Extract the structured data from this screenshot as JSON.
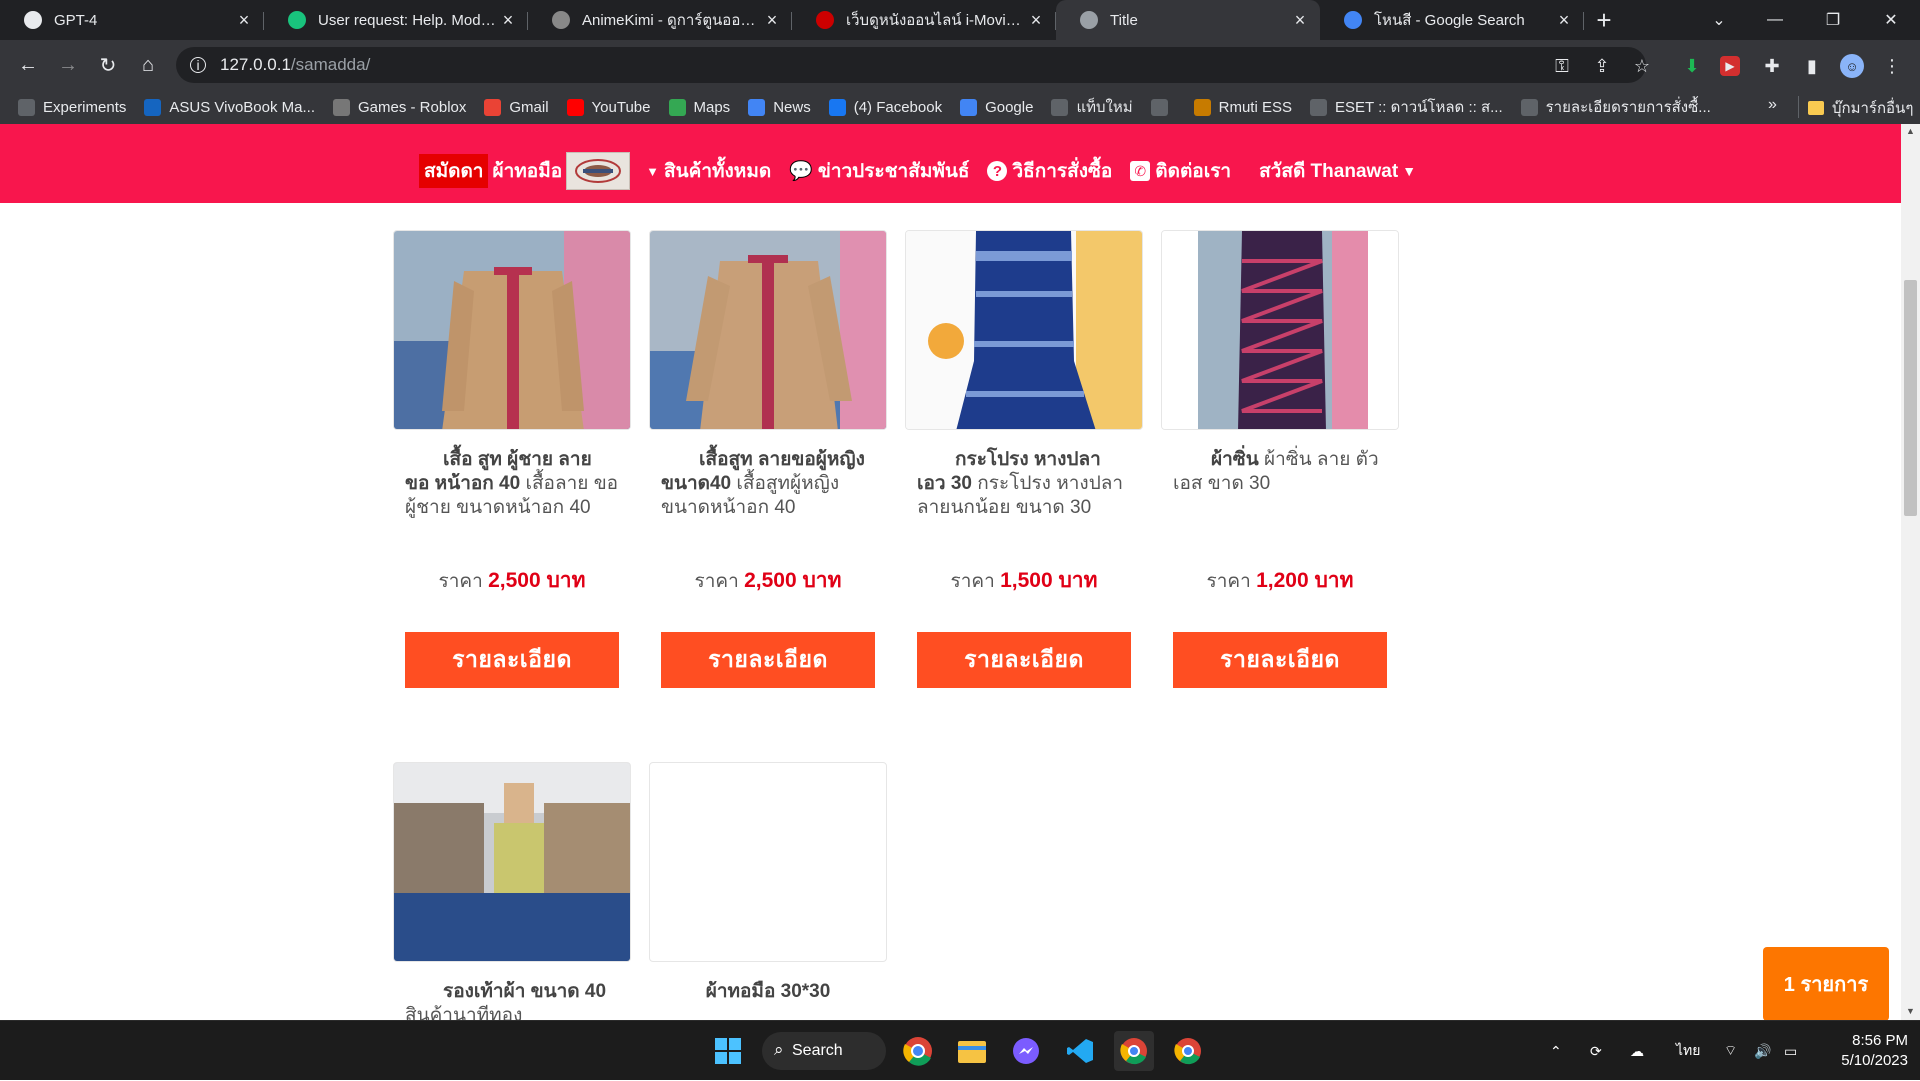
{
  "browser": {
    "tabs": [
      {
        "title": "GPT-4",
        "icon": "openai-icon",
        "color": "#e8eaed"
      },
      {
        "title": "User request: Help. Model r",
        "icon": "openai-icon",
        "color": "#19c37d"
      },
      {
        "title": "AnimeKimi - ดูการ์ตูนออนไลน์",
        "icon": "anime-icon",
        "color": "#888888"
      },
      {
        "title": "เว็บดูหนังออนไลน์ i-MovieHD u",
        "icon": "moviehd-icon",
        "color": "#cc0000"
      },
      {
        "title": "Title",
        "icon": "globe-icon",
        "color": "#9aa0a6",
        "active": true
      },
      {
        "title": "โหนสี - Google Search",
        "icon": "google-icon",
        "color": "#4285f4"
      }
    ],
    "url_host": "127.0.0.1",
    "url_path": "/samadda/",
    "bookmarks": [
      {
        "label": "Experiments",
        "icon": "flask-icon",
        "color": "#5f6368"
      },
      {
        "label": "ASUS VivoBook Ma...",
        "icon": "asus-icon",
        "color": "#1565c0"
      },
      {
        "label": "Games - Roblox",
        "icon": "roblox-icon",
        "color": "#777777"
      },
      {
        "label": "Gmail",
        "icon": "gmail-icon",
        "color": "#ea4335"
      },
      {
        "label": "YouTube",
        "icon": "youtube-icon",
        "color": "#ff0000"
      },
      {
        "label": "Maps",
        "icon": "maps-icon",
        "color": "#34a853"
      },
      {
        "label": "News",
        "icon": "news-icon",
        "color": "#4285f4"
      },
      {
        "label": "(4) Facebook",
        "icon": "facebook-icon",
        "color": "#1877f2"
      },
      {
        "label": "Google",
        "icon": "google-icon",
        "color": "#4285f4"
      },
      {
        "label": "แท็บใหม่",
        "icon": "globe-icon",
        "color": "#5f6368"
      },
      {
        "label": "",
        "icon": "globe-icon",
        "color": "#5f6368"
      },
      {
        "label": "Rmuti ESS",
        "icon": "rmuti-icon",
        "color": "#c77b00"
      },
      {
        "label": "ESET :: ดาวน์โหลด :: ส...",
        "icon": "globe-icon",
        "color": "#5f6368"
      },
      {
        "label": "รายละเอียดรายการสั่งซื้...",
        "icon": "globe-icon",
        "color": "#5f6368"
      }
    ],
    "bookmarks_overflow": "»",
    "other_bookmarks": "บุ๊กมาร์กอื่นๆ"
  },
  "site": {
    "brand_highlight": "สมัดดา",
    "brand_rest": "ผ้าทอมือ",
    "nav": [
      {
        "label": "สินค้าทั้งหมด",
        "icon": "caret-down-icon"
      },
      {
        "label": "ข่าวประชาสัมพันธ์",
        "icon": "comments-icon"
      },
      {
        "label": "วิธีการสั่งซื้อ",
        "icon": "question-circle-icon"
      },
      {
        "label": "ติดต่อเรา",
        "icon": "phone-icon"
      }
    ],
    "user_greeting": "สวัสดี Thanawat",
    "accent_color": "#f8164d",
    "button_color": "#ff4e22"
  },
  "products": [
    {
      "title": "เสื้อ สูท ผู้ชาย ลาย ขอ หน้าอก 40",
      "detail": "เสื้อลาย ขอ ผู้ชาย ขนาดหน้าอก 40",
      "price_label": "ราคา",
      "price": "2,500 บาท",
      "button": "รายละเอียด"
    },
    {
      "title": "เสื้อสูท ลายขอผู้หญิง ขนาด40",
      "detail": "เสื้อสูทผู้หญิง ขนาดหน้าอก 40",
      "price_label": "ราคา",
      "price": "2,500 บาท",
      "button": "รายละเอียด"
    },
    {
      "title": "กระโปรง หางปลา เอว 30",
      "detail": "กระโปรง หางปลา ลายนกน้อย ขนาด 30",
      "price_label": "ราคา",
      "price": "1,500 บาท",
      "button": "รายละเอียด"
    },
    {
      "title": "ผ้าซิ่น",
      "detail": "ผ้าซิ่น ลาย ตัวเอส ขาด 30",
      "price_label": "ราคา",
      "price": "1,200 บาท",
      "button": "รายละเอียด"
    },
    {
      "title": "รองเท้าผ้า ขนาด 40",
      "detail": "สินค้านาทีทอง",
      "price_label": "",
      "price": "",
      "button": ""
    },
    {
      "title": "ผ้าทอมือ 30*30",
      "detail": "",
      "price_label": "",
      "price": "",
      "button": ""
    }
  ],
  "cart": {
    "label": "1 รายการ"
  },
  "taskbar": {
    "search_label": "Search",
    "language": "ไทย",
    "time": "8:56 PM",
    "date": "5/10/2023"
  }
}
